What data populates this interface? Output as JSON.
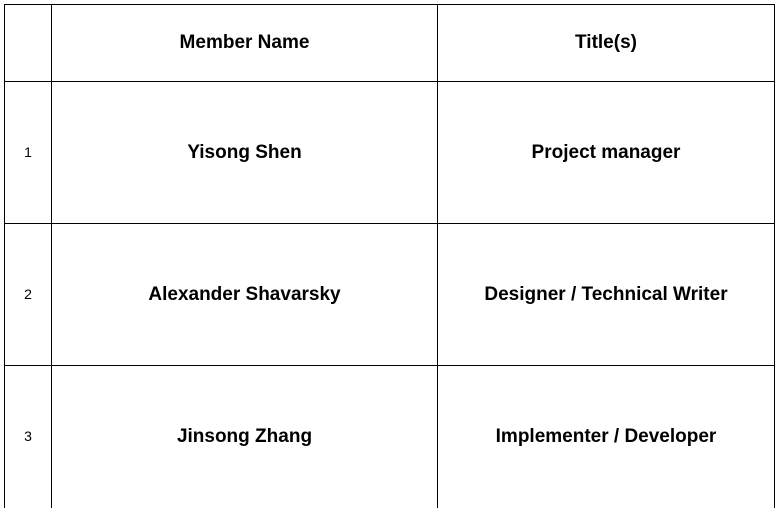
{
  "table": {
    "headers": [
      "",
      "Member Name",
      "Title(s)"
    ],
    "rows": [
      {
        "num": "1",
        "name": "Yisong Shen",
        "title": "Project manager"
      },
      {
        "num": "2",
        "name": "Alexander Shavarsky",
        "title": "Designer / Technical Writer"
      },
      {
        "num": "3",
        "name": "Jinsong Zhang",
        "title": "Implementer / Developer"
      }
    ]
  }
}
